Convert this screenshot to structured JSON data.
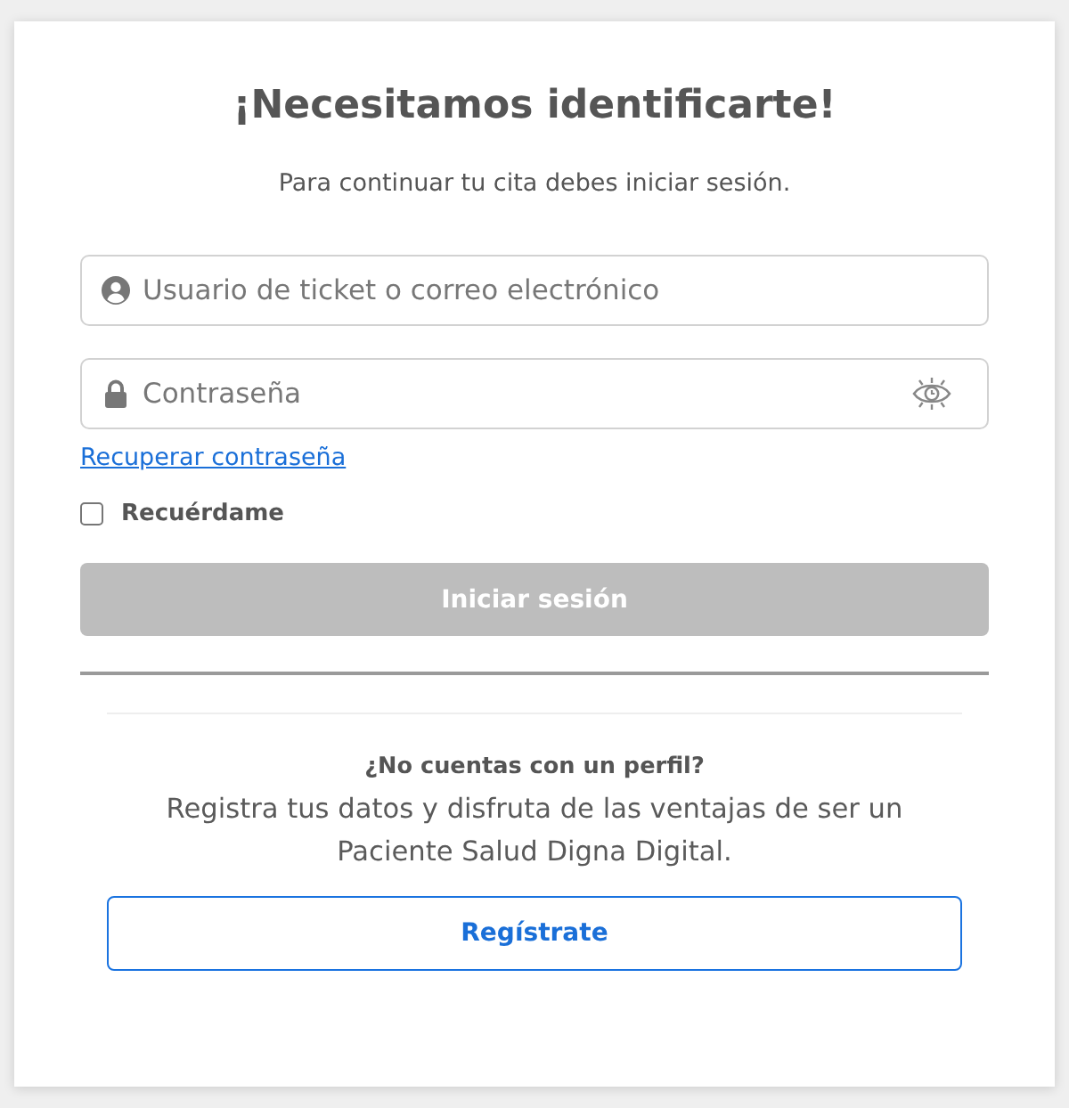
{
  "heading": {
    "title": "¡Necesitamos identificarte!",
    "subtitle": "Para continuar tu cita debes iniciar sesión."
  },
  "fields": [
    {
      "kind": "user",
      "placeholder": "Usuario de ticket o correo electrónico"
    },
    {
      "kind": "password",
      "placeholder": "Contraseña"
    }
  ],
  "recover_link": "Recuperar contraseña",
  "remember": {
    "label": "Recuérdame",
    "checked": false
  },
  "login_button": {
    "label": "Iniciar sesión",
    "disabled": true
  },
  "register": {
    "question": "¿No cuentas con un perfil?",
    "text": "Registra tus datos y disfruta de las ventajas de ser un Paciente Salud Digna Digital.",
    "button": "Regístrate"
  }
}
